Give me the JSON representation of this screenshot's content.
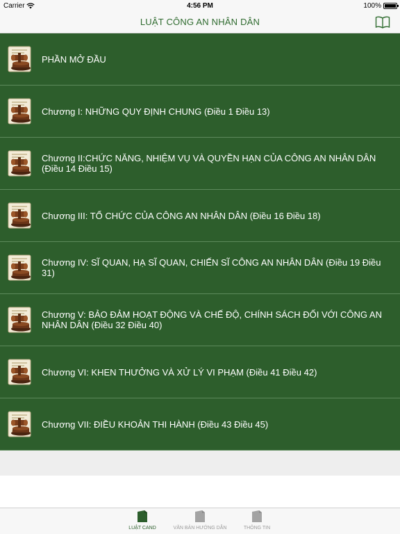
{
  "status_bar": {
    "carrier": "Carrier",
    "time": "4:56 PM",
    "battery": "100%"
  },
  "nav": {
    "title": "LUẬT CÔNG AN NHÂN DÂN"
  },
  "chapters": [
    {
      "label": "PHẦN MỞ ĐẦU"
    },
    {
      "label": "Chương I: NHỮNG QUY ĐỊNH CHUNG (Điều 1 Điều 13)"
    },
    {
      "label": "Chương II:CHỨC NĂNG, NHIỆM VỤ VÀ QUYỀN HẠN CỦA CÔNG AN NHÂN DÂN (Điều 14 Điều 15)"
    },
    {
      "label": "Chương III: TỔ CHỨC CỦA CÔNG AN NHÂN DÂN (Điều 16 Điều 18)"
    },
    {
      "label": "Chương IV: SĨ QUAN, HẠ SĨ QUAN, CHIẾN SĨ CÔNG AN NHÂN DÂN (Điều 19 Điều 31)"
    },
    {
      "label": "Chương V: BẢO ĐẢM HOẠT ĐỘNG VÀ CHẾ ĐỘ, CHÍNH SÁCH ĐỐI VỚI CÔNG AN NHÂN DÂN (Điều 32 Điều 40)"
    },
    {
      "label": "Chương VI: KHEN THƯỞNG VÀ XỬ LÝ VI PHẠM (Điều 41 Điều 42)"
    },
    {
      "label": "Chương VII: ĐIỀU KHOẢN THI HÀNH (Điều 43 Điều 45)"
    }
  ],
  "tabs": [
    {
      "label": "LUẬT CAND",
      "active": true
    },
    {
      "label": "VĂN BẢN HƯỚNG DẪN",
      "active": false
    },
    {
      "label": "THÔNG TIN",
      "active": false
    }
  ],
  "colors": {
    "row_background": "#2d5e2c",
    "accent": "#2f6b2f",
    "tab_inactive": "#9a9a9a"
  },
  "icons": {
    "row": "law-scroll-gavel-icon",
    "nav_right": "book-icon",
    "tab": "document-folder-icon",
    "wifi": "wifi-icon",
    "battery": "battery-icon"
  }
}
